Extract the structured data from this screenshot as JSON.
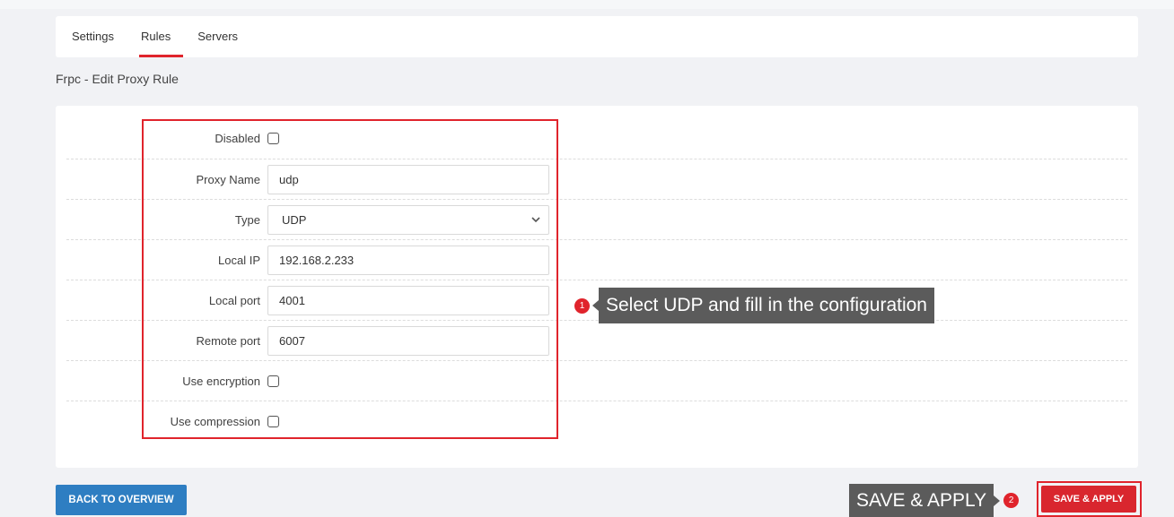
{
  "tabs": [
    {
      "label": "Settings"
    },
    {
      "label": "Rules"
    },
    {
      "label": "Servers"
    }
  ],
  "page_title": "Frpc - Edit Proxy Rule",
  "form": {
    "disabled_label": "Disabled",
    "proxy_name_label": "Proxy Name",
    "proxy_name_value": "udp",
    "type_label": "Type",
    "type_value": "UDP",
    "local_ip_label": "Local IP",
    "local_ip_value": "192.168.2.233",
    "local_port_label": "Local port",
    "local_port_value": "4001",
    "remote_port_label": "Remote port",
    "remote_port_value": "6007",
    "use_encryption_label": "Use encryption",
    "use_compression_label": "Use compression"
  },
  "callouts": [
    {
      "number": "1",
      "text": "Select UDP and fill in the configuration"
    },
    {
      "number": "2",
      "text": "SAVE & APPLY"
    }
  ],
  "buttons": {
    "back_label": "BACK TO OVERVIEW",
    "save_label": "SAVE & APPLY"
  },
  "colors": {
    "accent_red": "#e0242c",
    "back_button_blue": "#2e7ec2",
    "callout_gray": "#5b5b5b"
  }
}
